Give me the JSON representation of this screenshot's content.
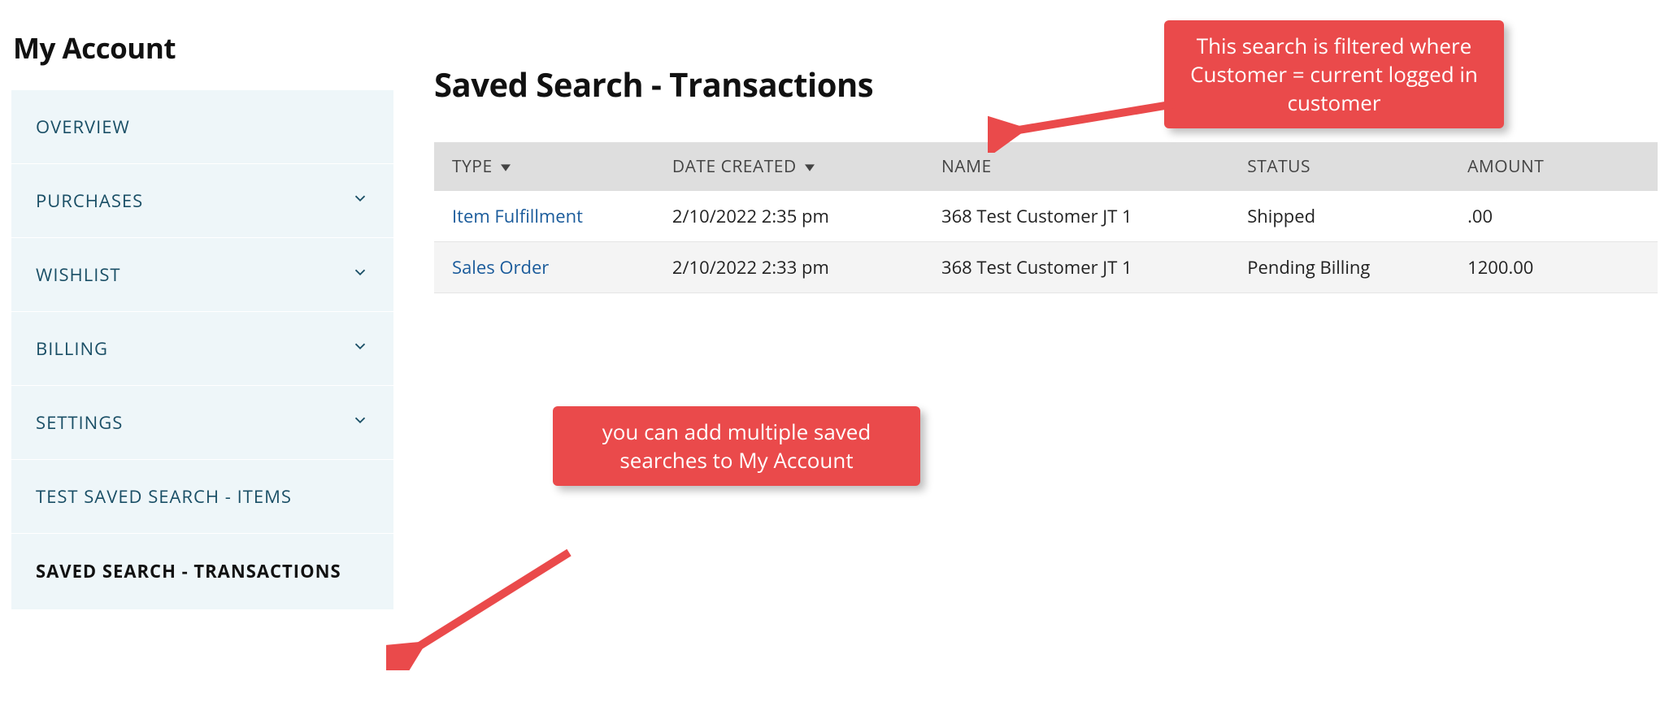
{
  "page_title": "My Account",
  "sidebar": {
    "items": [
      {
        "label": "OVERVIEW",
        "expandable": false
      },
      {
        "label": "PURCHASES",
        "expandable": true
      },
      {
        "label": "WISHLIST",
        "expandable": true
      },
      {
        "label": "BILLING",
        "expandable": true
      },
      {
        "label": "SETTINGS",
        "expandable": true
      },
      {
        "label": "TEST SAVED SEARCH - ITEMS",
        "expandable": false
      },
      {
        "label": "SAVED SEARCH - TRANSACTIONS",
        "expandable": false,
        "active": true
      }
    ]
  },
  "main": {
    "title": "Saved Search - Transactions",
    "columns": {
      "type": "TYPE",
      "date": "DATE CREATED",
      "name": "NAME",
      "status": "STATUS",
      "amount": "AMOUNT"
    },
    "rows": [
      {
        "type": "Item Fulfillment",
        "date": "2/10/2022 2:35 pm",
        "name": "368 Test Customer JT 1",
        "status": "Shipped",
        "amount": ".00"
      },
      {
        "type": "Sales Order",
        "date": "2/10/2022 2:33 pm",
        "name": "368 Test Customer JT 1",
        "status": "Pending Billing",
        "amount": "1200.00"
      }
    ]
  },
  "callouts": {
    "top": "This search is filtered where Customer = current logged in customer",
    "bottom": "you can add multiple saved searches to My Account"
  },
  "colors": {
    "sidebar_bg": "#eef6f9",
    "sidebar_fg": "#1a4f66",
    "link": "#1a5b9b",
    "callout": "#ea4a4b"
  }
}
